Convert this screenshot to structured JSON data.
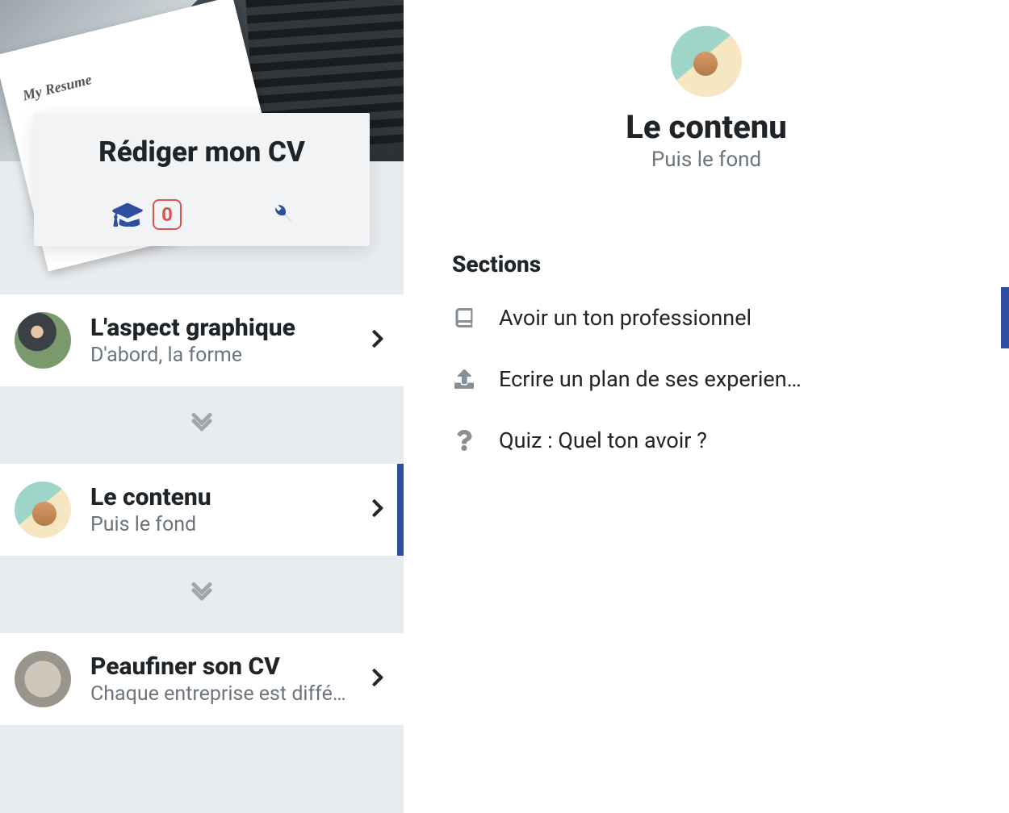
{
  "course": {
    "title": "Rédiger mon CV",
    "points": "0"
  },
  "chapters": [
    {
      "title": "L'aspect graphique",
      "subtitle": "D'abord, la forme",
      "active": false
    },
    {
      "title": "Le contenu",
      "subtitle": "Puis le fond",
      "active": true
    },
    {
      "title": "Peaufiner son CV",
      "subtitle": "Chaque entreprise est diffé…",
      "active": false
    }
  ],
  "main": {
    "title": "Le contenu",
    "subtitle": "Puis le fond",
    "sections_heading": "Sections",
    "sections": [
      {
        "icon": "book",
        "label": "Avoir un ton professionnel",
        "active": true
      },
      {
        "icon": "upload",
        "label": "Ecrire un plan de ses experien…",
        "active": false
      },
      {
        "icon": "question",
        "label": "Quiz : Quel ton avoir ?",
        "active": false
      }
    ]
  }
}
